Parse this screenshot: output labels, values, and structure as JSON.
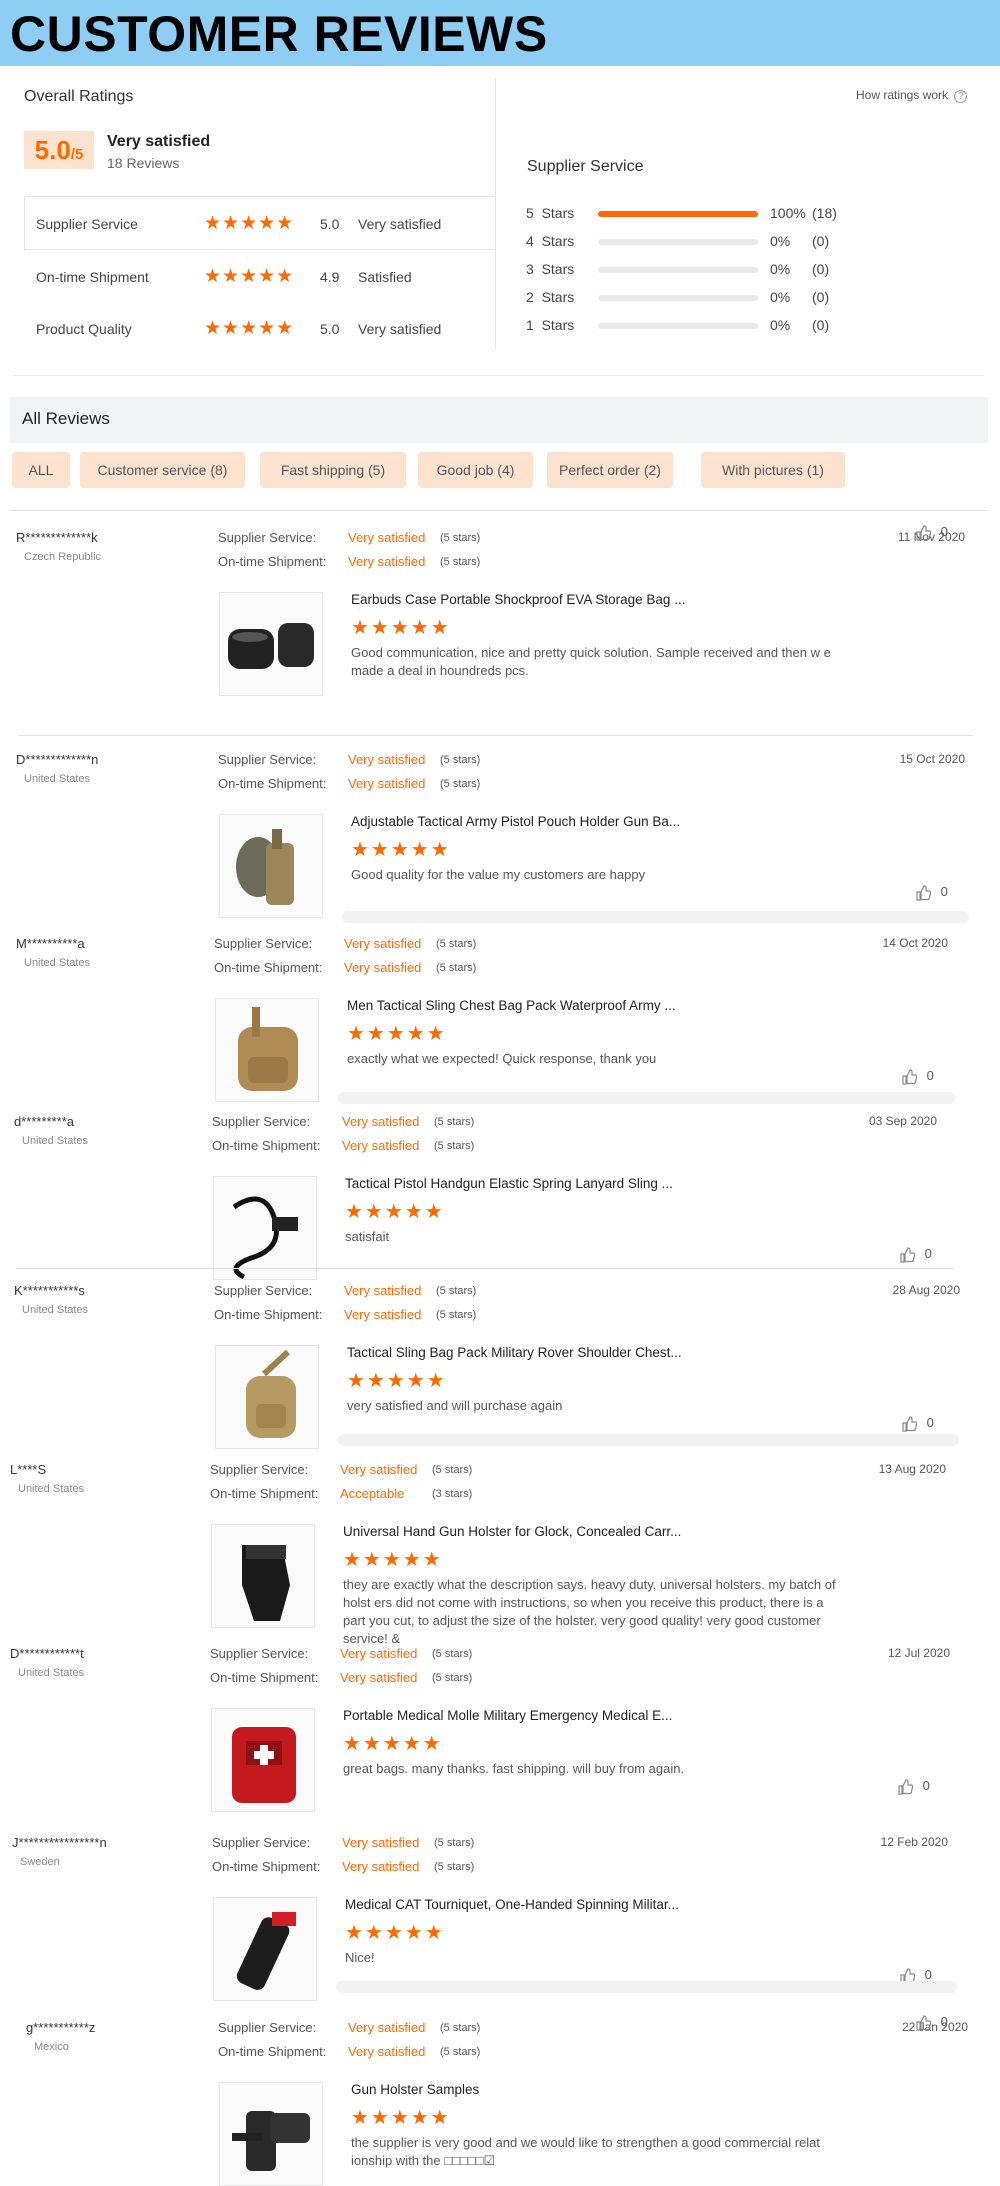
{
  "banner": {
    "title": "CUSTOMER REVIEWS"
  },
  "overall": {
    "heading": "Overall Ratings",
    "how_link": "How ratings work",
    "help_icon": "question-circle-icon",
    "score": "5.0",
    "score_suffix": "/5",
    "verdict": "Very satisfied",
    "reviews_count": "18 Reviews",
    "metrics": [
      {
        "label": "Supplier Service",
        "stars": "★★★★★",
        "score": "5.0",
        "verdict": "Very satisfied"
      },
      {
        "label": "On-time Shipment",
        "stars": "★★★★★",
        "score": "4.9",
        "verdict": "Satisfied"
      },
      {
        "label": "Product Quality",
        "stars": "★★★★★",
        "score": "5.0",
        "verdict": "Very satisfied"
      }
    ],
    "breakdown_title": "Supplier Service",
    "breakdown": [
      {
        "label": "5  Stars",
        "pct": "100%",
        "count": "(18)",
        "fill": 1.0
      },
      {
        "label": "4  Stars",
        "pct": "0%",
        "count": "(0)",
        "fill": 0
      },
      {
        "label": "3  Stars",
        "pct": "0%",
        "count": "(0)",
        "fill": 0
      },
      {
        "label": "2  Stars",
        "pct": "0%",
        "count": "(0)",
        "fill": 0
      },
      {
        "label": "1  Stars",
        "pct": "0%",
        "count": "(0)",
        "fill": 0
      }
    ]
  },
  "all_reviews": {
    "heading": "All Reviews",
    "filters": [
      "ALL",
      "Customer service (8)",
      "Fast shipping (5)",
      "Good job (4)",
      "Perfect order (2)",
      "With pictures (1)"
    ]
  },
  "labels": {
    "supplier": "Supplier Service:",
    "shipment": "On-time Shipment:"
  },
  "reviews": [
    {
      "user": "R*************k",
      "country": "Czech Republic",
      "date": "11 Nov 2020",
      "supplier": "Very satisfied",
      "supplier_stars": "(5 stars)",
      "shipment": "Very satisfied",
      "shipment_stars": "(5 stars)",
      "product": "Earbuds Case Portable Shockproof EVA Storage Bag ...",
      "rating": "★★★★★",
      "comment": "Good communication, nice and pretty quick solution. Sample received and then w e made a deal in houndreds pcs.",
      "likes": "0"
    },
    {
      "user": "D*************n",
      "country": "United States",
      "date": "15 Oct 2020",
      "supplier": "Very satisfied",
      "supplier_stars": "(5 stars)",
      "shipment": "Very satisfied",
      "shipment_stars": "(5 stars)",
      "product": "Adjustable Tactical Army Pistol Pouch Holder Gun Ba...",
      "rating": "★★★★★",
      "comment": "Good quality for the value my customers are happy",
      "likes": "0"
    },
    {
      "user": "M**********a",
      "country": "United States",
      "date": "14 Oct 2020",
      "supplier": "Very satisfied",
      "supplier_stars": "(5 stars)",
      "shipment": "Very satisfied",
      "shipment_stars": "(5 stars)",
      "product": "Men Tactical Sling Chest Bag Pack Waterproof Army ...",
      "rating": "★★★★★",
      "comment": "exactly what we expected! Quick response, thank you",
      "likes": "0"
    },
    {
      "user": "d*********a",
      "country": "United States",
      "date": "03 Sep 2020",
      "supplier": "Very satisfied",
      "supplier_stars": "(5 stars)",
      "shipment": "Very satisfied",
      "shipment_stars": "(5 stars)",
      "product": "Tactical Pistol Handgun Elastic Spring Lanyard Sling ...",
      "rating": "★★★★★",
      "comment": "satisfait",
      "likes": "0"
    },
    {
      "user": "K***********s",
      "country": "United States",
      "date": "28 Aug 2020",
      "supplier": "Very satisfied",
      "supplier_stars": "(5 stars)",
      "shipment": "Very satisfied",
      "shipment_stars": "(5 stars)",
      "product": "Tactical Sling Bag Pack Military Rover Shoulder Chest...",
      "rating": "★★★★★",
      "comment": "very satisfied and will purchase again",
      "likes": "0"
    },
    {
      "user": "L****S",
      "country": "United States",
      "date": "13 Aug 2020",
      "supplier": "Very satisfied",
      "supplier_stars": "(5 stars)",
      "shipment": "Acceptable",
      "shipment_stars": "(3 stars)",
      "product": "Universal Hand Gun Holster for Glock, Concealed Carr...",
      "rating": "★★★★★",
      "comment": "they are exactly what the description says. heavy duty, universal holsters. my batch of holst ers did not come with instructions, so when you receive this product, there is a part you cut, to adjust the size of the holster. very good quality! very good customer service! &",
      "likes": ""
    },
    {
      "user": "D************t",
      "country": "United States",
      "date": "12 Jul 2020",
      "supplier": "Very satisfied",
      "supplier_stars": "(5 stars)",
      "shipment": "Very satisfied",
      "shipment_stars": "(5 stars)",
      "product": "Portable Medical Molle Military Emergency Medical E...",
      "rating": "★★★★★",
      "comment": "great bags. many thanks. fast shipping. will buy from again.",
      "likes": "0"
    },
    {
      "user": "J****************n",
      "country": "Sweden",
      "date": "12 Feb 2020",
      "supplier": "Very satisfied",
      "supplier_stars": "(5 stars)",
      "shipment": "Very satisfied",
      "shipment_stars": "(5 stars)",
      "product": "Medical CAT Tourniquet, One-Handed Spinning Militar...",
      "rating": "★★★★★",
      "comment": "Nice!",
      "likes": "0"
    },
    {
      "user": "g***********z",
      "country": "Mexico",
      "date": "22 Jan 2020",
      "supplier": "Very satisfied",
      "supplier_stars": "(5 stars)",
      "shipment": "Very satisfied",
      "shipment_stars": "(5 stars)",
      "product": "Gun Holster Samples",
      "rating": "★★★★★",
      "comment": "the supplier is very good and we would like to strengthen a good commercial relat ionship with the □□□□□☑",
      "likes": "0"
    }
  ],
  "colors": {
    "accent": "#ff6a00",
    "banner": "#8ecdf4",
    "chip": "#fde3cf"
  }
}
